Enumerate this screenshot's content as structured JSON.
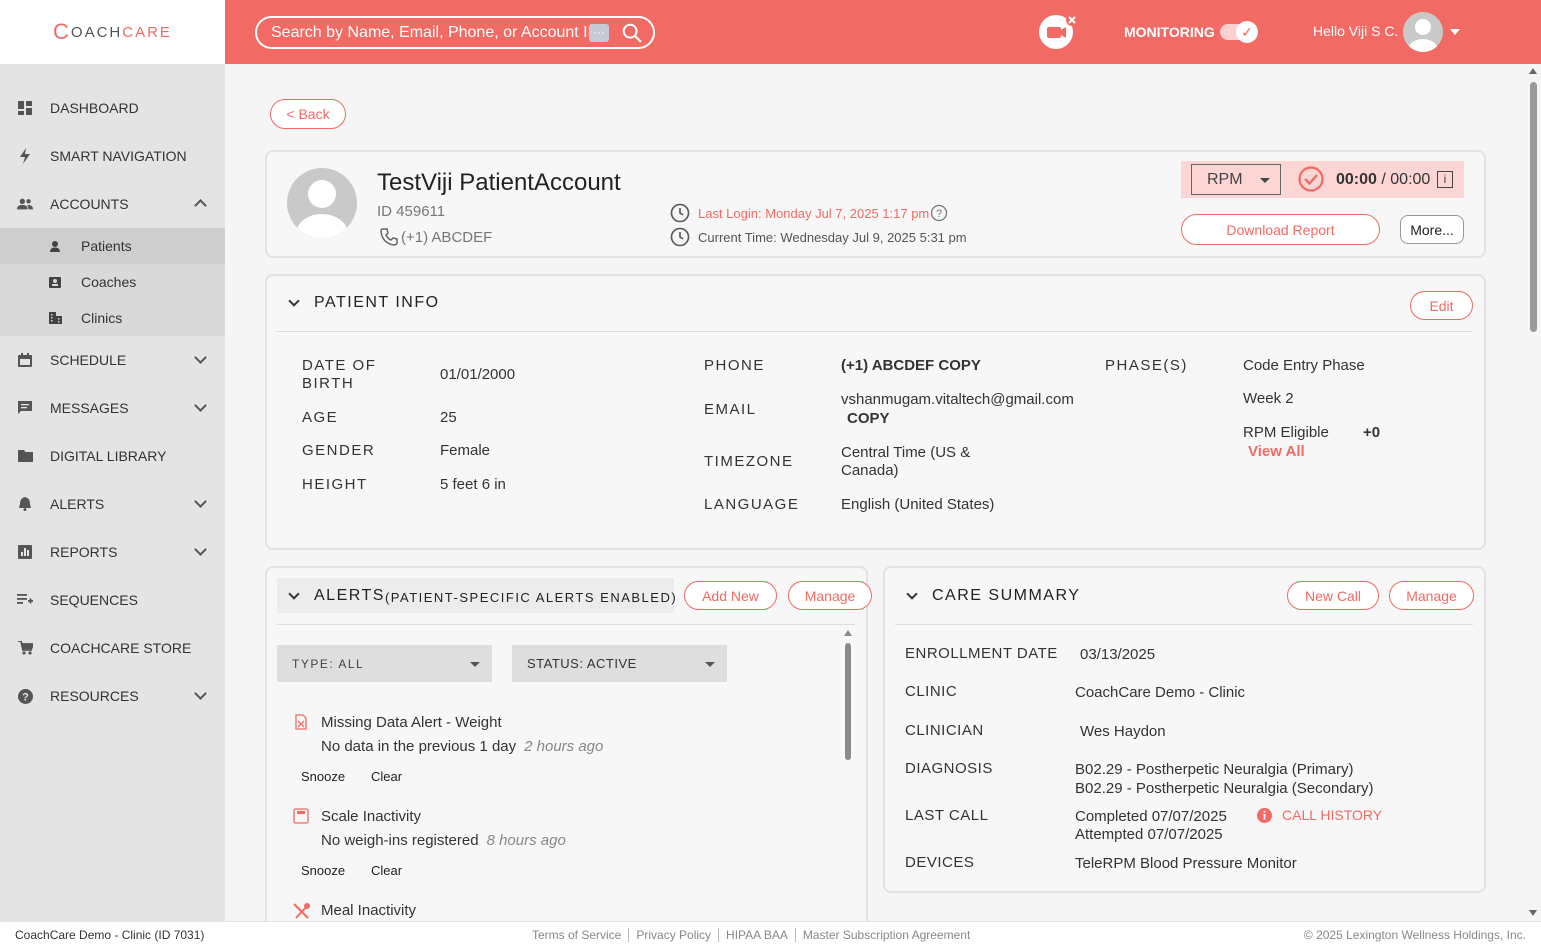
{
  "header": {
    "logo": "COACHCARE",
    "logo_c": "C",
    "logo_coach": "OACH",
    "logo_care": "CARE",
    "search_placeholder": "Search by Name, Email, Phone, or Account ID",
    "search_more": "···",
    "monitoring_label": "MONITORING",
    "greeting": "Hello Viji S C."
  },
  "sidebar": {
    "items": [
      {
        "label": "DASHBOARD"
      },
      {
        "label": "SMART NAVIGATION"
      },
      {
        "label": "ACCOUNTS"
      },
      {
        "label": "SCHEDULE"
      },
      {
        "label": "MESSAGES"
      },
      {
        "label": "DIGITAL LIBRARY"
      },
      {
        "label": "ALERTS"
      },
      {
        "label": "REPORTS"
      },
      {
        "label": "SEQUENCES"
      },
      {
        "label": "COACHCARE STORE"
      },
      {
        "label": "RESOURCES"
      }
    ],
    "sub_items": [
      {
        "label": "Patients"
      },
      {
        "label": "Coaches"
      },
      {
        "label": "Clinics"
      }
    ]
  },
  "main": {
    "back_label": "< Back",
    "patient": {
      "name": "TestViji PatientAccount",
      "id": "ID 459611",
      "phone": "(+1) ABCDEF",
      "last_login": "Last Login: Monday Jul 7, 2025 1:17 pm",
      "current_time": "Current Time: Wednesday Jul 9, 2025 5:31 pm"
    },
    "rpm": {
      "program": "RPM",
      "timer_elapsed": "00:00",
      "timer_sep": " / ",
      "timer_total": "00:00",
      "info": "i"
    },
    "download_report": "Download Report",
    "more": "More...",
    "patient_info": {
      "title": "PATIENT INFO",
      "edit": "Edit",
      "dob_label": "DATE OF BIRTH",
      "dob": "01/01/2000",
      "age_label": "AGE",
      "age": "25",
      "gender_label": "GENDER",
      "gender": "Female",
      "height_label": "HEIGHT",
      "height": "5 feet 6 in",
      "phone_label": "PHONE",
      "phone": "(+1) ABCDEF",
      "copy": "COPY",
      "email_label": "EMAIL",
      "email": "vshanmugam.vitaltech@gmail.com",
      "timezone_label": "TIMEZONE",
      "timezone": "Central Time (US & Canada)",
      "language_label": "LANGUAGE",
      "language": "English (United States)",
      "phases_label": "PHASE(S)",
      "phase1": "Code Entry Phase",
      "phase2": "Week 2",
      "phase3": "RPM Eligible",
      "phase_more": "+0",
      "view_all": "View All"
    },
    "alerts": {
      "title": "ALERTS",
      "title_sub": "(PATIENT-SPECIFIC ALERTS ENABLED)",
      "add_new": "Add New",
      "manage": "Manage",
      "type_filter": "TYPE: ALL",
      "status_filter": "STATUS: ACTIVE",
      "snooze": "Snooze",
      "clear": "Clear",
      "items": [
        {
          "title": "Missing Data Alert - Weight",
          "desc": "No data in the previous 1 day",
          "time": "2 hours ago"
        },
        {
          "title": "Scale Inactivity",
          "desc": "No weigh-ins registered",
          "time": "8 hours ago"
        },
        {
          "title": "Meal Inactivity"
        }
      ]
    },
    "care_summary": {
      "title": "CARE SUMMARY",
      "new_call": "New Call",
      "manage": "Manage",
      "enrollment_label": "ENROLLMENT DATE",
      "enrollment": "03/13/2025",
      "clinic_label": "CLINIC",
      "clinic": "CoachCare Demo - Clinic",
      "clinician_label": "CLINICIAN",
      "clinician": "Wes Haydon",
      "diagnosis_label": "DIAGNOSIS",
      "diagnosis1": "B02.29 - Postherpetic Neuralgia (Primary)",
      "diagnosis2": "B02.29 - Postherpetic Neuralgia (Secondary)",
      "last_call_label": "LAST CALL",
      "last_call1": "Completed 07/07/2025",
      "last_call2": "Attempted 07/07/2025",
      "call_history": "CALL HISTORY",
      "devices_label": "DEVICES",
      "devices": "TeleRPM Blood Pressure Monitor"
    }
  },
  "footer": {
    "clinic": "CoachCare Demo - Clinic (ID 7031)",
    "links": [
      "Terms of Service",
      "Privacy Policy",
      "HIPAA BAA",
      "Master Subscription Agreement"
    ],
    "copyright": "© 2025 Lexington Wellness Holdings, Inc."
  },
  "colors": {
    "brand": "#f26a64",
    "sidebar": "#e4e4e4"
  }
}
